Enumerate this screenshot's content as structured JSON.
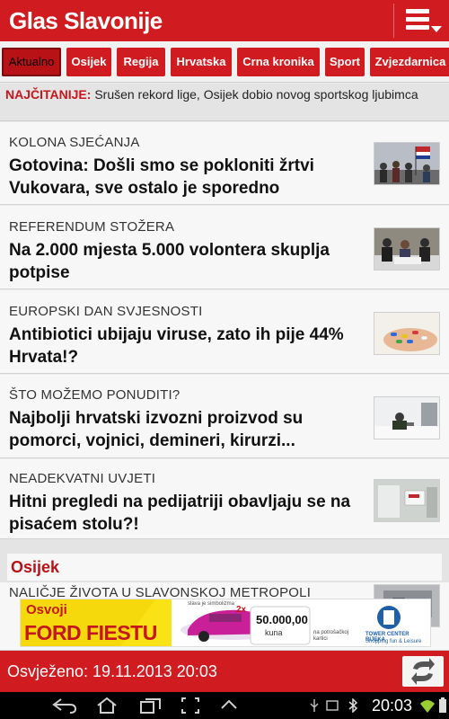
{
  "header": {
    "logo": "Glas Slavonije",
    "menu_icon": "menu-icon"
  },
  "tabs": [
    {
      "label": "Aktualno",
      "active": true
    },
    {
      "label": "Osijek"
    },
    {
      "label": "Regija"
    },
    {
      "label": "Hrvatska"
    },
    {
      "label": "Crna kronika"
    },
    {
      "label": "Sport"
    },
    {
      "label": "Zvjezdarnica"
    }
  ],
  "ticker": {
    "label": "NAJČITANIJE:",
    "text": "Srušen rekord lige, Osijek dobio novog sportskog ljubimca"
  },
  "articles": [
    {
      "category": "KOLONA SJEĆANJA",
      "title": "Gotovina: Došli smo se pokloniti žrtvi Vukovara, sve ostalo je sporedno"
    },
    {
      "category": "REFERENDUM STOŽERA",
      "title": "Na 2.000 mjesta 5.000 volontera skuplja potpise"
    },
    {
      "category": "EUROPSKI DAN SVJESNOSTI",
      "title": "Antibiotici ubijaju viruse, zato ih pije 44% Hrvata!?"
    },
    {
      "category": "ŠTO MOŽEMO PONUDITI?",
      "title": "Najbolji hrvatski izvozni proizvod su pomorci, vojnici, demineri, kirurzi..."
    },
    {
      "category": "NEADEKVATNI UVJETI",
      "title": "Hitni pregledi na pedijatriji obavljaju se na pisaćem stolu?!"
    }
  ],
  "section": {
    "label": "Osijek",
    "first_category": "NALIČJE ŽIVOTA U SLAVONSKOJ METROPOLI"
  },
  "ad": {
    "line1": "Osvoji",
    "line2": "FORD FIESTU",
    "small": "slava je simbolizma",
    "mult": "2x",
    "amount": "50.000,00",
    "currency": "kuna",
    "note": "na potrošačkoj kartici",
    "brand": "TOWER CENTER RIJEKA",
    "brand_sub": "Shopping fun & Leisure"
  },
  "status": {
    "refreshed": "Osvježeno: 19.11.2013 20:03"
  },
  "system": {
    "time": "20:03"
  },
  "colors": {
    "brand": "#d01c20",
    "dark_red": "#b81217",
    "background": "#ececec",
    "card": "#f7f7f7"
  }
}
